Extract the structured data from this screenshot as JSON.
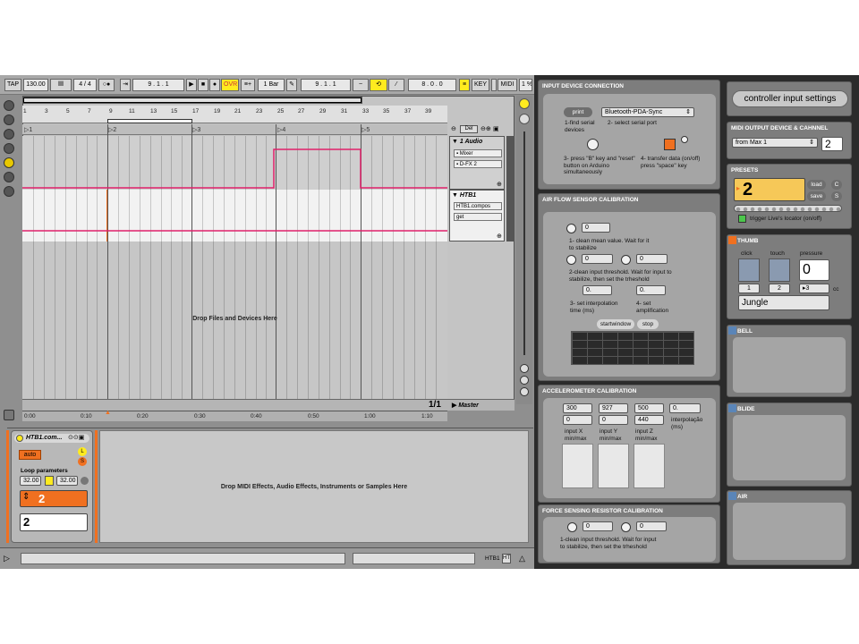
{
  "transport": {
    "tap": "TAP",
    "tempo": "130.00",
    "sig": "4 / 4",
    "ovr": "OVR",
    "quant": "1 Bar",
    "pos1": "9 . 1 . 1",
    "pos2": "9 . 1 . 1",
    "pos3": "8 . 0 . 0",
    "key": "KEY",
    "midi": "MIDI",
    "cpu": "1 %"
  },
  "arrangement": {
    "ruler": [
      "1",
      "3",
      "5",
      "7",
      "9",
      "11",
      "13",
      "15",
      "17",
      "19",
      "21",
      "23",
      "25",
      "27",
      "29",
      "31",
      "33",
      "35",
      "37",
      "39"
    ],
    "locators": [
      "1",
      "2",
      "3",
      "4",
      "5"
    ],
    "drop_text": "Drop Files and Devices Here",
    "times": [
      "0:00",
      "0:10",
      "0:20",
      "0:30",
      "0:40",
      "0:50",
      "1:00",
      "1:10"
    ],
    "pager": "1/1",
    "master": "Master",
    "del": "Del",
    "track1": {
      "name": "1 Audio",
      "mixer": "Mixer",
      "fx": "D-FX 2"
    },
    "track2": {
      "name": "HTB1",
      "device": "HTB1.compos",
      "param": "get"
    }
  },
  "clip": {
    "name": "HTB1.com...",
    "auto": "auto",
    "l": "L",
    "s": "S",
    "loop_label": "Loop parameters",
    "loop_a": "32.00",
    "loop_b": "32.00",
    "value": "2",
    "box": "2"
  },
  "detail": {
    "drop_text": "Drop MIDI Effects, Audio Effects, Instruments or Samples Here"
  },
  "statusbar": {
    "track": "HTB1",
    "ht": "HT"
  },
  "input_device": {
    "title": "INPUT DEVICE CONNECTION",
    "print": "print",
    "port": "Bluetooth-PDA-Sync",
    "step1": "1-find serial devices",
    "step2": "2- select serial port",
    "step3": "3- press \"B\" key and \"reset\" button on Arduino simultaneously",
    "step4": "4- transfer data (on/off) press \"space\" key"
  },
  "airflow": {
    "title": "AIR FLOW SENSOR CALIBRATION",
    "v1": "0",
    "s1": "1- clean mean value. Wait for it to stabilize",
    "v2": "0",
    "v3": "0",
    "s2": "2-clean input threshold. Wait for input to stabilize, then set the trheshold",
    "v4": "0.",
    "v5": "0.",
    "s3": "3- set interpolation time (ms)",
    "s4": "4- set amplification",
    "start": "startwindow",
    "stop": "stop"
  },
  "accel": {
    "title": "ACCELEROMETER CALIBRATION",
    "x_max": "300",
    "y_max": "927",
    "z_max": "500",
    "interp": "0.",
    "x_min": "0",
    "y_min": "0",
    "z_min": "440",
    "interp_label": "interpolação (ms)",
    "x_label": "input X min/max",
    "y_label": "input Y min/max",
    "z_label": "input Z min/max"
  },
  "force": {
    "title": "FORCE SENSING RESISTOR CALIBRATION",
    "v1": "0",
    "v2": "0",
    "label": "1-clean input threshold. Wait for input to stabilize, then set the trheshold"
  },
  "controller": {
    "button": "controller input settings"
  },
  "midi_out": {
    "title": "MIDI OUTPUT DEVICE & CAHNNEL",
    "device": "from Max 1",
    "channel": "2"
  },
  "presets": {
    "title": "PRESETS",
    "value": "2",
    "load": "load",
    "save": "save",
    "c": "C",
    "s": "S",
    "trigger": "trigger Live's locator (on/off)"
  },
  "thumb": {
    "title": "THUMB",
    "click": "click",
    "touch": "touch",
    "pressure": "pressure",
    "pressure_val": "0",
    "n1": "1",
    "n2": "2",
    "n3": "3",
    "cc": "cc",
    "name": "Jungle"
  },
  "bell": {
    "title": "BELL"
  },
  "blide": {
    "title": "BLIDE"
  },
  "air": {
    "title": "AIR"
  },
  "colors": {
    "accent_orange": "#f07020",
    "preset_yellow": "#f6c858",
    "envelope": "#e0206a",
    "cyan": "#5a85b8"
  }
}
